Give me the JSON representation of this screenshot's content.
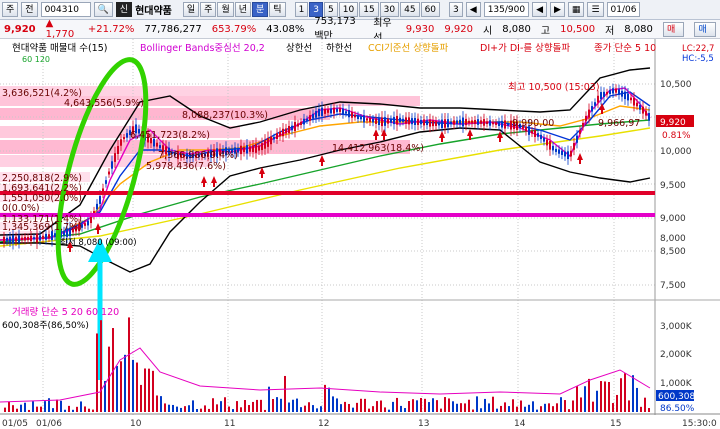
{
  "toolbar": {
    "code_prefix": "주",
    "market_dropdown": "전",
    "stock_code": "004310",
    "corp_badge": "신",
    "stock_name": "현대약품",
    "period_buttons": [
      "일",
      "주",
      "월",
      "년",
      "분",
      "틱"
    ],
    "active_period": "분",
    "minute_buttons": [
      "1",
      "3",
      "5",
      "10",
      "15",
      "30",
      "45",
      "60"
    ],
    "active_minute": "3",
    "count_value": "3",
    "page_count": "135/900",
    "date_value": "01/06",
    "buy_button": "매수",
    "sell_button": "매도"
  },
  "quote": {
    "price": "9,920",
    "change": "▲ 1,770",
    "change_pct": "+21.72%",
    "volume": "77,786,277",
    "volume_ratio": "653.79%",
    "turnover_pct": "43.08%",
    "amount": "753,173백만",
    "best_ask_label": "최우선",
    "best_ask": "9,930",
    "best_bid": "9,920",
    "open_label": "시",
    "open": "8,080",
    "high_label": "고",
    "high": "10,500",
    "low_label": "저",
    "low": "8,080"
  },
  "legend": {
    "title": "현대약품 매물대 수(15)",
    "bb": "Bollinger Bands중심선 20,2",
    "bb_upper": "상한선",
    "bb_lower": "하한선",
    "cci": "CCI기준선 상향돌파",
    "dmi": "DI+가 DI-를 상향돌파",
    "ma": "종가 단순 5  10",
    "ma2": "60  120",
    "lc": "LC:22,7",
    "hc": "HC:-5,5"
  },
  "annotations": {
    "max": "최고 10,500 (15:03)",
    "min": "최저 8,080 (09:00)",
    "vp1": "3,636,521(4.2%)",
    "vp2": "4,643,556(5.9%)",
    "vp3": "8,088,237(10.3%)",
    "vp4": "6,451,723(8.2%)",
    "vp5": "7,366,986(9.4%)",
    "vp6": "5,978,436(7.6%)",
    "vp7": "14,412,963(18.4%)",
    "vp8": "2,250,818(2.9%)",
    "vp9": "1,693,641(2.2%)",
    "vp10": "1,551,050(2.0%)",
    "vp11": "0(0.0%)",
    "vp12": "1,345,369(1.7%)",
    "vp13": "1,133,171(1.4%)",
    "vp14": "9,990,00",
    "vp15": "9,966,97"
  },
  "price_axis": {
    "ticks": [
      "10,500",
      "10,000",
      "9,500",
      "9,000",
      "8,500",
      "8,000",
      "7,500"
    ],
    "current": "9,920",
    "current_pct": "0.81%"
  },
  "volume_panel": {
    "title": "거래량  단순 5  20  60  120",
    "value": "600,308주(86,50%)",
    "ticks": [
      "3,000K",
      "2,000K",
      "1,000K"
    ],
    "current": "600,308",
    "current_pct": "86.50%"
  },
  "time_axis": {
    "labels": [
      "01/05",
      "01/06",
      "10",
      "11",
      "12",
      "13",
      "14",
      "15"
    ],
    "clock": "15:30:0"
  },
  "colors": {
    "upper_line_red": "#e0002a",
    "lower_line_magenta": "#e400c8",
    "highlight_green": "#32d200",
    "arrow_cyan": "#00e6ff",
    "vol_up": "#d2001f",
    "vol_down": "#0038c8"
  }
}
